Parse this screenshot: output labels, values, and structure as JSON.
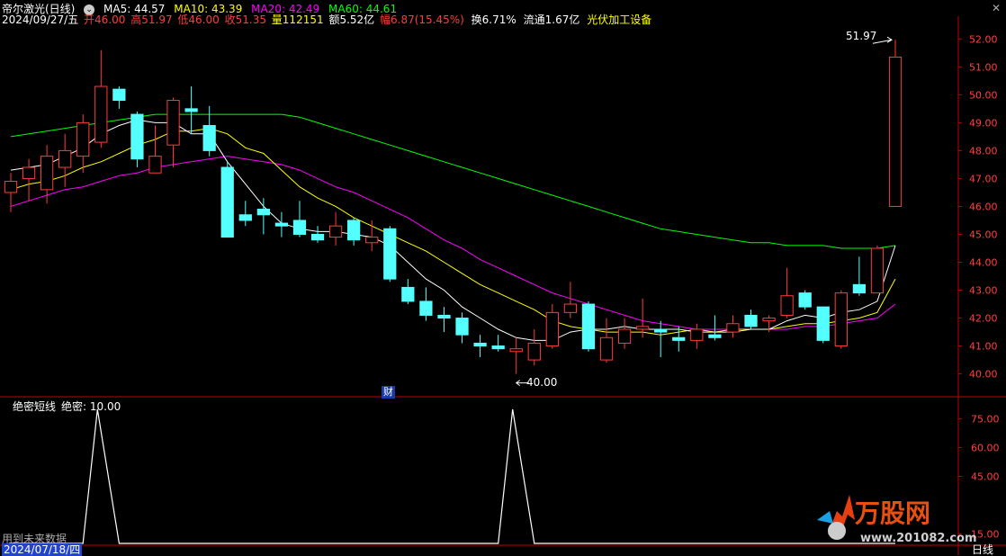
{
  "header": {
    "title": "帝尔激光(日线)",
    "ma5": "MA5: 44.57",
    "ma10": "MA10: 43.39",
    "ma20": "MA20: 42.49",
    "ma60": "MA60: 44.61",
    "date": "2024/09/27/五",
    "open": "开46.00",
    "high": "高51.97",
    "low": "低46.00",
    "close": "收51.35",
    "volume": "量112151",
    "amount": "额5.52亿",
    "change": "幅6.87(15.45%)",
    "turnover": "换6.71%",
    "float": "流通1.67亿",
    "sector": "光伏加工设备",
    "win_close": "✕",
    "win_more": "⌄"
  },
  "colors": {
    "up": "#ff3b3b",
    "down": "#54ffff",
    "ma5": "#ffffff",
    "ma10": "#ffff00",
    "ma20": "#ff00ff",
    "ma60": "#00ff00",
    "axis": "#c00000"
  },
  "annotations": {
    "high_label": "51.97",
    "low_label": "40.00",
    "finance_tag": "财"
  },
  "indicator": {
    "name": "绝密短线",
    "value_label": "绝密: 10.00",
    "future_note": "用到未来数据",
    "y_ticks": [
      "75.00",
      "60.00",
      "45.00",
      "15.00"
    ],
    "values": [
      0,
      0,
      0,
      0,
      0,
      100,
      0,
      0,
      0,
      0,
      0,
      0,
      0,
      0,
      0,
      0,
      0,
      0,
      0,
      0,
      0,
      0,
      0,
      0,
      0,
      0,
      0,
      0,
      100,
      0,
      0,
      0,
      0,
      0,
      0,
      0,
      0,
      0,
      0,
      0,
      0,
      0,
      0,
      0,
      0,
      0,
      0,
      0,
      0,
      0
    ]
  },
  "bottom": {
    "start_date": "2024/07/18/四",
    "period": "日线"
  },
  "price_axis": [
    "52.00",
    "51.00",
    "50.00",
    "49.00",
    "48.00",
    "47.00",
    "46.00",
    "45.00",
    "44.00",
    "43.00",
    "42.00",
    "41.00",
    "40.00"
  ],
  "chart_data": {
    "type": "candlestick",
    "title": "帝尔激光(日线)",
    "ylim": [
      39.6,
      52.3
    ],
    "candles": [
      {
        "o": 46.5,
        "c": 46.9,
        "h": 47.2,
        "l": 45.8
      },
      {
        "o": 47.0,
        "c": 47.4,
        "h": 47.7,
        "l": 46.2
      },
      {
        "o": 46.6,
        "c": 47.8,
        "h": 48.2,
        "l": 46.1
      },
      {
        "o": 47.4,
        "c": 48.0,
        "h": 48.6,
        "l": 46.7
      },
      {
        "o": 47.8,
        "c": 49.0,
        "h": 49.3,
        "l": 47.2
      },
      {
        "o": 48.3,
        "c": 50.3,
        "h": 51.6,
        "l": 48.1
      },
      {
        "o": 50.2,
        "c": 49.8,
        "h": 50.3,
        "l": 49.5
      },
      {
        "o": 49.3,
        "c": 47.7,
        "h": 49.4,
        "l": 47.4
      },
      {
        "o": 47.2,
        "c": 47.8,
        "h": 48.9,
        "l": 47.2
      },
      {
        "o": 48.2,
        "c": 49.8,
        "h": 49.9,
        "l": 47.4
      },
      {
        "o": 49.5,
        "c": 49.4,
        "h": 50.3,
        "l": 48.6
      },
      {
        "o": 48.9,
        "c": 48.0,
        "h": 49.6,
        "l": 47.8
      },
      {
        "o": 47.4,
        "c": 44.9,
        "h": 47.6,
        "l": 44.9
      },
      {
        "o": 45.7,
        "c": 45.5,
        "h": 46.2,
        "l": 45.3
      },
      {
        "o": 45.9,
        "c": 45.7,
        "h": 46.3,
        "l": 45.0
      },
      {
        "o": 45.4,
        "c": 45.3,
        "h": 45.8,
        "l": 44.9
      },
      {
        "o": 45.5,
        "c": 45.0,
        "h": 46.2,
        "l": 44.9
      },
      {
        "o": 45.0,
        "c": 44.8,
        "h": 45.3,
        "l": 44.7
      },
      {
        "o": 44.9,
        "c": 45.3,
        "h": 45.8,
        "l": 44.6
      },
      {
        "o": 45.5,
        "c": 44.8,
        "h": 45.6,
        "l": 44.6
      },
      {
        "o": 44.7,
        "c": 44.9,
        "h": 45.5,
        "l": 44.4
      },
      {
        "o": 45.2,
        "c": 43.4,
        "h": 45.3,
        "l": 43.3
      },
      {
        "o": 43.1,
        "c": 42.6,
        "h": 43.4,
        "l": 42.5
      },
      {
        "o": 42.6,
        "c": 42.1,
        "h": 43.1,
        "l": 41.9
      },
      {
        "o": 42.1,
        "c": 42.0,
        "h": 42.4,
        "l": 41.5
      },
      {
        "o": 42.0,
        "c": 41.4,
        "h": 42.2,
        "l": 41.1
      },
      {
        "o": 41.1,
        "c": 41.0,
        "h": 41.4,
        "l": 40.6
      },
      {
        "o": 41.0,
        "c": 40.9,
        "h": 41.4,
        "l": 40.8
      },
      {
        "o": 40.8,
        "c": 40.9,
        "h": 41.3,
        "l": 40.0
      },
      {
        "o": 40.5,
        "c": 41.1,
        "h": 41.6,
        "l": 40.3
      },
      {
        "o": 41.0,
        "c": 42.2,
        "h": 42.5,
        "l": 40.9
      },
      {
        "o": 42.2,
        "c": 42.5,
        "h": 43.3,
        "l": 42.0
      },
      {
        "o": 42.5,
        "c": 40.9,
        "h": 42.6,
        "l": 40.8
      },
      {
        "o": 40.5,
        "c": 41.3,
        "h": 42.0,
        "l": 40.4
      },
      {
        "o": 41.1,
        "c": 41.6,
        "h": 42.0,
        "l": 40.9
      },
      {
        "o": 41.6,
        "c": 41.7,
        "h": 42.7,
        "l": 41.3
      },
      {
        "o": 41.6,
        "c": 41.5,
        "h": 41.9,
        "l": 40.6
      },
      {
        "o": 41.3,
        "c": 41.2,
        "h": 41.7,
        "l": 40.8
      },
      {
        "o": 41.2,
        "c": 41.6,
        "h": 41.8,
        "l": 40.9
      },
      {
        "o": 41.4,
        "c": 41.3,
        "h": 42.1,
        "l": 41.2
      },
      {
        "o": 41.5,
        "c": 41.8,
        "h": 42.1,
        "l": 41.3
      },
      {
        "o": 42.1,
        "c": 41.7,
        "h": 42.3,
        "l": 41.6
      },
      {
        "o": 41.9,
        "c": 42.0,
        "h": 42.1,
        "l": 41.5
      },
      {
        "o": 42.1,
        "c": 42.8,
        "h": 43.8,
        "l": 42.0
      },
      {
        "o": 42.9,
        "c": 42.4,
        "h": 43.0,
        "l": 42.3
      },
      {
        "o": 42.4,
        "c": 41.2,
        "h": 42.4,
        "l": 41.1
      },
      {
        "o": 41.0,
        "c": 42.9,
        "h": 43.0,
        "l": 40.9
      },
      {
        "o": 43.2,
        "c": 42.9,
        "h": 44.2,
        "l": 42.8
      },
      {
        "o": 42.9,
        "c": 44.5,
        "h": 44.6,
        "l": 42.9
      },
      {
        "o": 46.0,
        "c": 51.35,
        "h": 51.97,
        "l": 46.0
      }
    ],
    "ma5": [
      47.3,
      47.4,
      47.5,
      47.8,
      48.1,
      48.6,
      48.9,
      49.1,
      49.0,
      49.0,
      48.6,
      48.6,
      47.6,
      46.8,
      46.0,
      45.4,
      45.2,
      45.1,
      45.1,
      45.0,
      44.9,
      44.6,
      44.0,
      43.4,
      43.0,
      42.4,
      42.0,
      41.6,
      41.3,
      41.2,
      41.2,
      41.5,
      41.6,
      41.6,
      41.7,
      41.6,
      41.6,
      41.6,
      41.5,
      41.5,
      41.5,
      41.6,
      41.6,
      41.9,
      42.1,
      42.0,
      42.2,
      42.3,
      42.6,
      44.6
    ],
    "ma10": [
      46.6,
      46.8,
      46.9,
      47.1,
      47.4,
      47.6,
      47.9,
      48.2,
      48.4,
      48.7,
      48.7,
      48.8,
      48.6,
      48.1,
      47.9,
      47.3,
      46.7,
      46.3,
      46.0,
      45.6,
      45.3,
      45.0,
      44.7,
      44.4,
      44.0,
      43.6,
      43.2,
      42.9,
      42.6,
      42.3,
      41.9,
      41.7,
      41.6,
      41.5,
      41.5,
      41.5,
      41.4,
      41.5,
      41.6,
      41.5,
      41.6,
      41.6,
      41.6,
      41.7,
      41.8,
      41.8,
      41.9,
      42.0,
      42.2,
      43.4
    ],
    "ma20": [
      46.0,
      46.2,
      46.4,
      46.6,
      46.7,
      46.9,
      47.1,
      47.2,
      47.4,
      47.5,
      47.6,
      47.7,
      47.8,
      47.7,
      47.6,
      47.5,
      47.3,
      47.0,
      46.7,
      46.5,
      46.2,
      45.9,
      45.6,
      45.2,
      44.8,
      44.5,
      44.1,
      43.8,
      43.5,
      43.2,
      42.9,
      42.7,
      42.5,
      42.3,
      42.1,
      41.9,
      41.8,
      41.7,
      41.6,
      41.6,
      41.6,
      41.6,
      41.6,
      41.6,
      41.7,
      41.7,
      41.8,
      41.9,
      42.0,
      42.5
    ],
    "ma60": [
      48.5,
      48.6,
      48.7,
      48.8,
      48.9,
      49.0,
      49.1,
      49.2,
      49.3,
      49.3,
      49.3,
      49.3,
      49.3,
      49.3,
      49.3,
      49.3,
      49.2,
      49.0,
      48.8,
      48.6,
      48.4,
      48.2,
      48.0,
      47.8,
      47.6,
      47.4,
      47.2,
      47.0,
      46.8,
      46.6,
      46.4,
      46.2,
      46.0,
      45.8,
      45.6,
      45.4,
      45.2,
      45.1,
      45.0,
      44.9,
      44.8,
      44.7,
      44.7,
      44.6,
      44.6,
      44.6,
      44.5,
      44.5,
      44.5,
      44.6
    ]
  }
}
